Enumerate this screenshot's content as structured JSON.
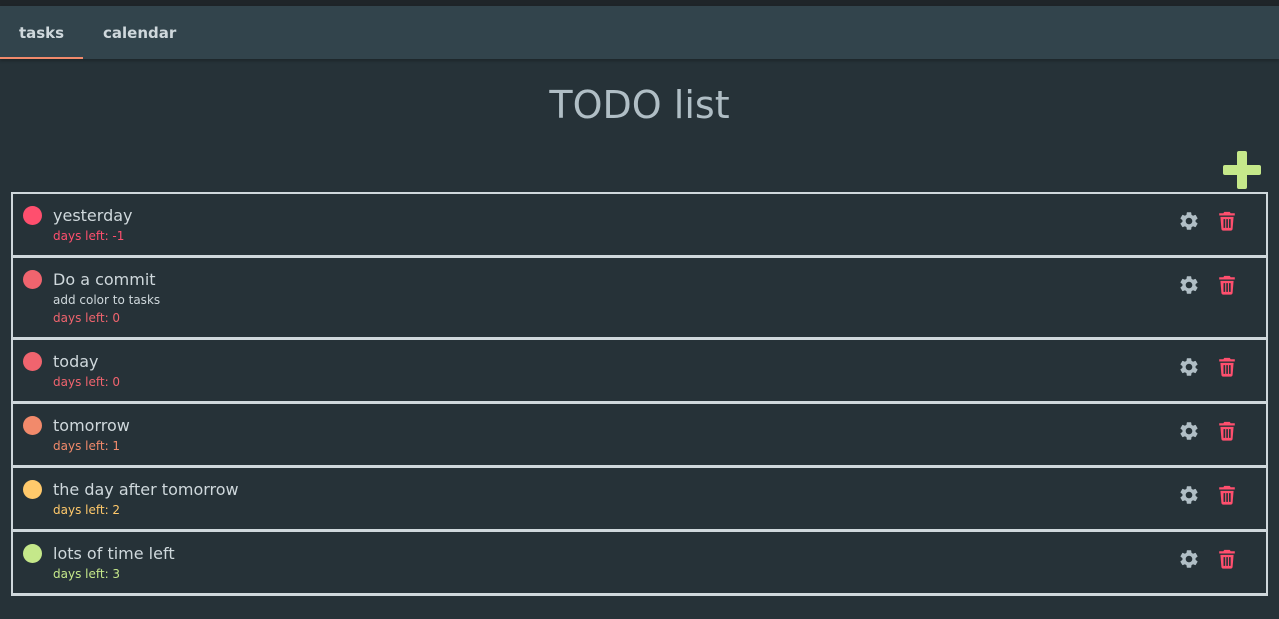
{
  "tabs": [
    {
      "label": "tasks",
      "active": true
    },
    {
      "label": "calendar",
      "active": false
    }
  ],
  "page_title": "TODO list",
  "add_icon": "plus-icon",
  "colors": {
    "background": "#263238",
    "tabbar": "#32444c",
    "tab_indicator": "#f28a6b",
    "add_button": "#c5e88a",
    "settings_icon": "#b0bec5",
    "delete_icon": "#ff4f6e"
  },
  "tasks": [
    {
      "title": "yesterday",
      "description": "",
      "days_label": "days left: -1",
      "color": "#ff4f6e"
    },
    {
      "title": "Do a commit",
      "description": "add color to tasks",
      "days_label": "days left: 0",
      "color": "#f0646e"
    },
    {
      "title": "today",
      "description": "",
      "days_label": "days left: 0",
      "color": "#f0646e"
    },
    {
      "title": "tomorrow",
      "description": "",
      "days_label": "days left: 1",
      "color": "#f28a6b"
    },
    {
      "title": "the day after tomorrow",
      "description": "",
      "days_label": "days left: 2",
      "color": "#ffc96b"
    },
    {
      "title": "lots of time left",
      "description": "",
      "days_label": "days left: 3",
      "color": "#c5e88a"
    }
  ],
  "item_icons": {
    "settings": "gear-icon",
    "delete": "trash-icon"
  }
}
